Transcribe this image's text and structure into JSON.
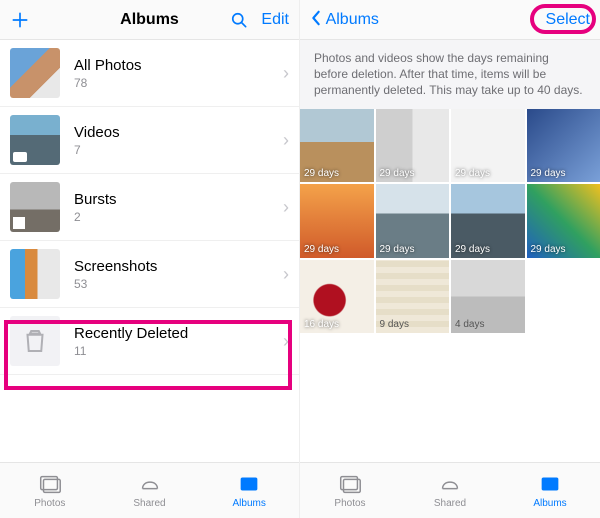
{
  "left": {
    "title": "Albums",
    "edit": "Edit",
    "albums": [
      {
        "name": "All Photos",
        "count": "78"
      },
      {
        "name": "Videos",
        "count": "7"
      },
      {
        "name": "Bursts",
        "count": "2"
      },
      {
        "name": "Screenshots",
        "count": "53"
      },
      {
        "name": "Recently Deleted",
        "count": "11"
      }
    ]
  },
  "right": {
    "back": "Albums",
    "select": "Select",
    "banner": "Photos and videos show the days remaining before deletion. After that time, items will be permanently deleted. This may take up to 40 days.",
    "cells": [
      "29 days",
      "29 days",
      "29 days",
      "29 days",
      "29 days",
      "29 days",
      "29 days",
      "29 days",
      "16 days",
      "9 days",
      "4 days"
    ]
  },
  "tabs": {
    "photos": "Photos",
    "shared": "Shared",
    "albums": "Albums"
  }
}
